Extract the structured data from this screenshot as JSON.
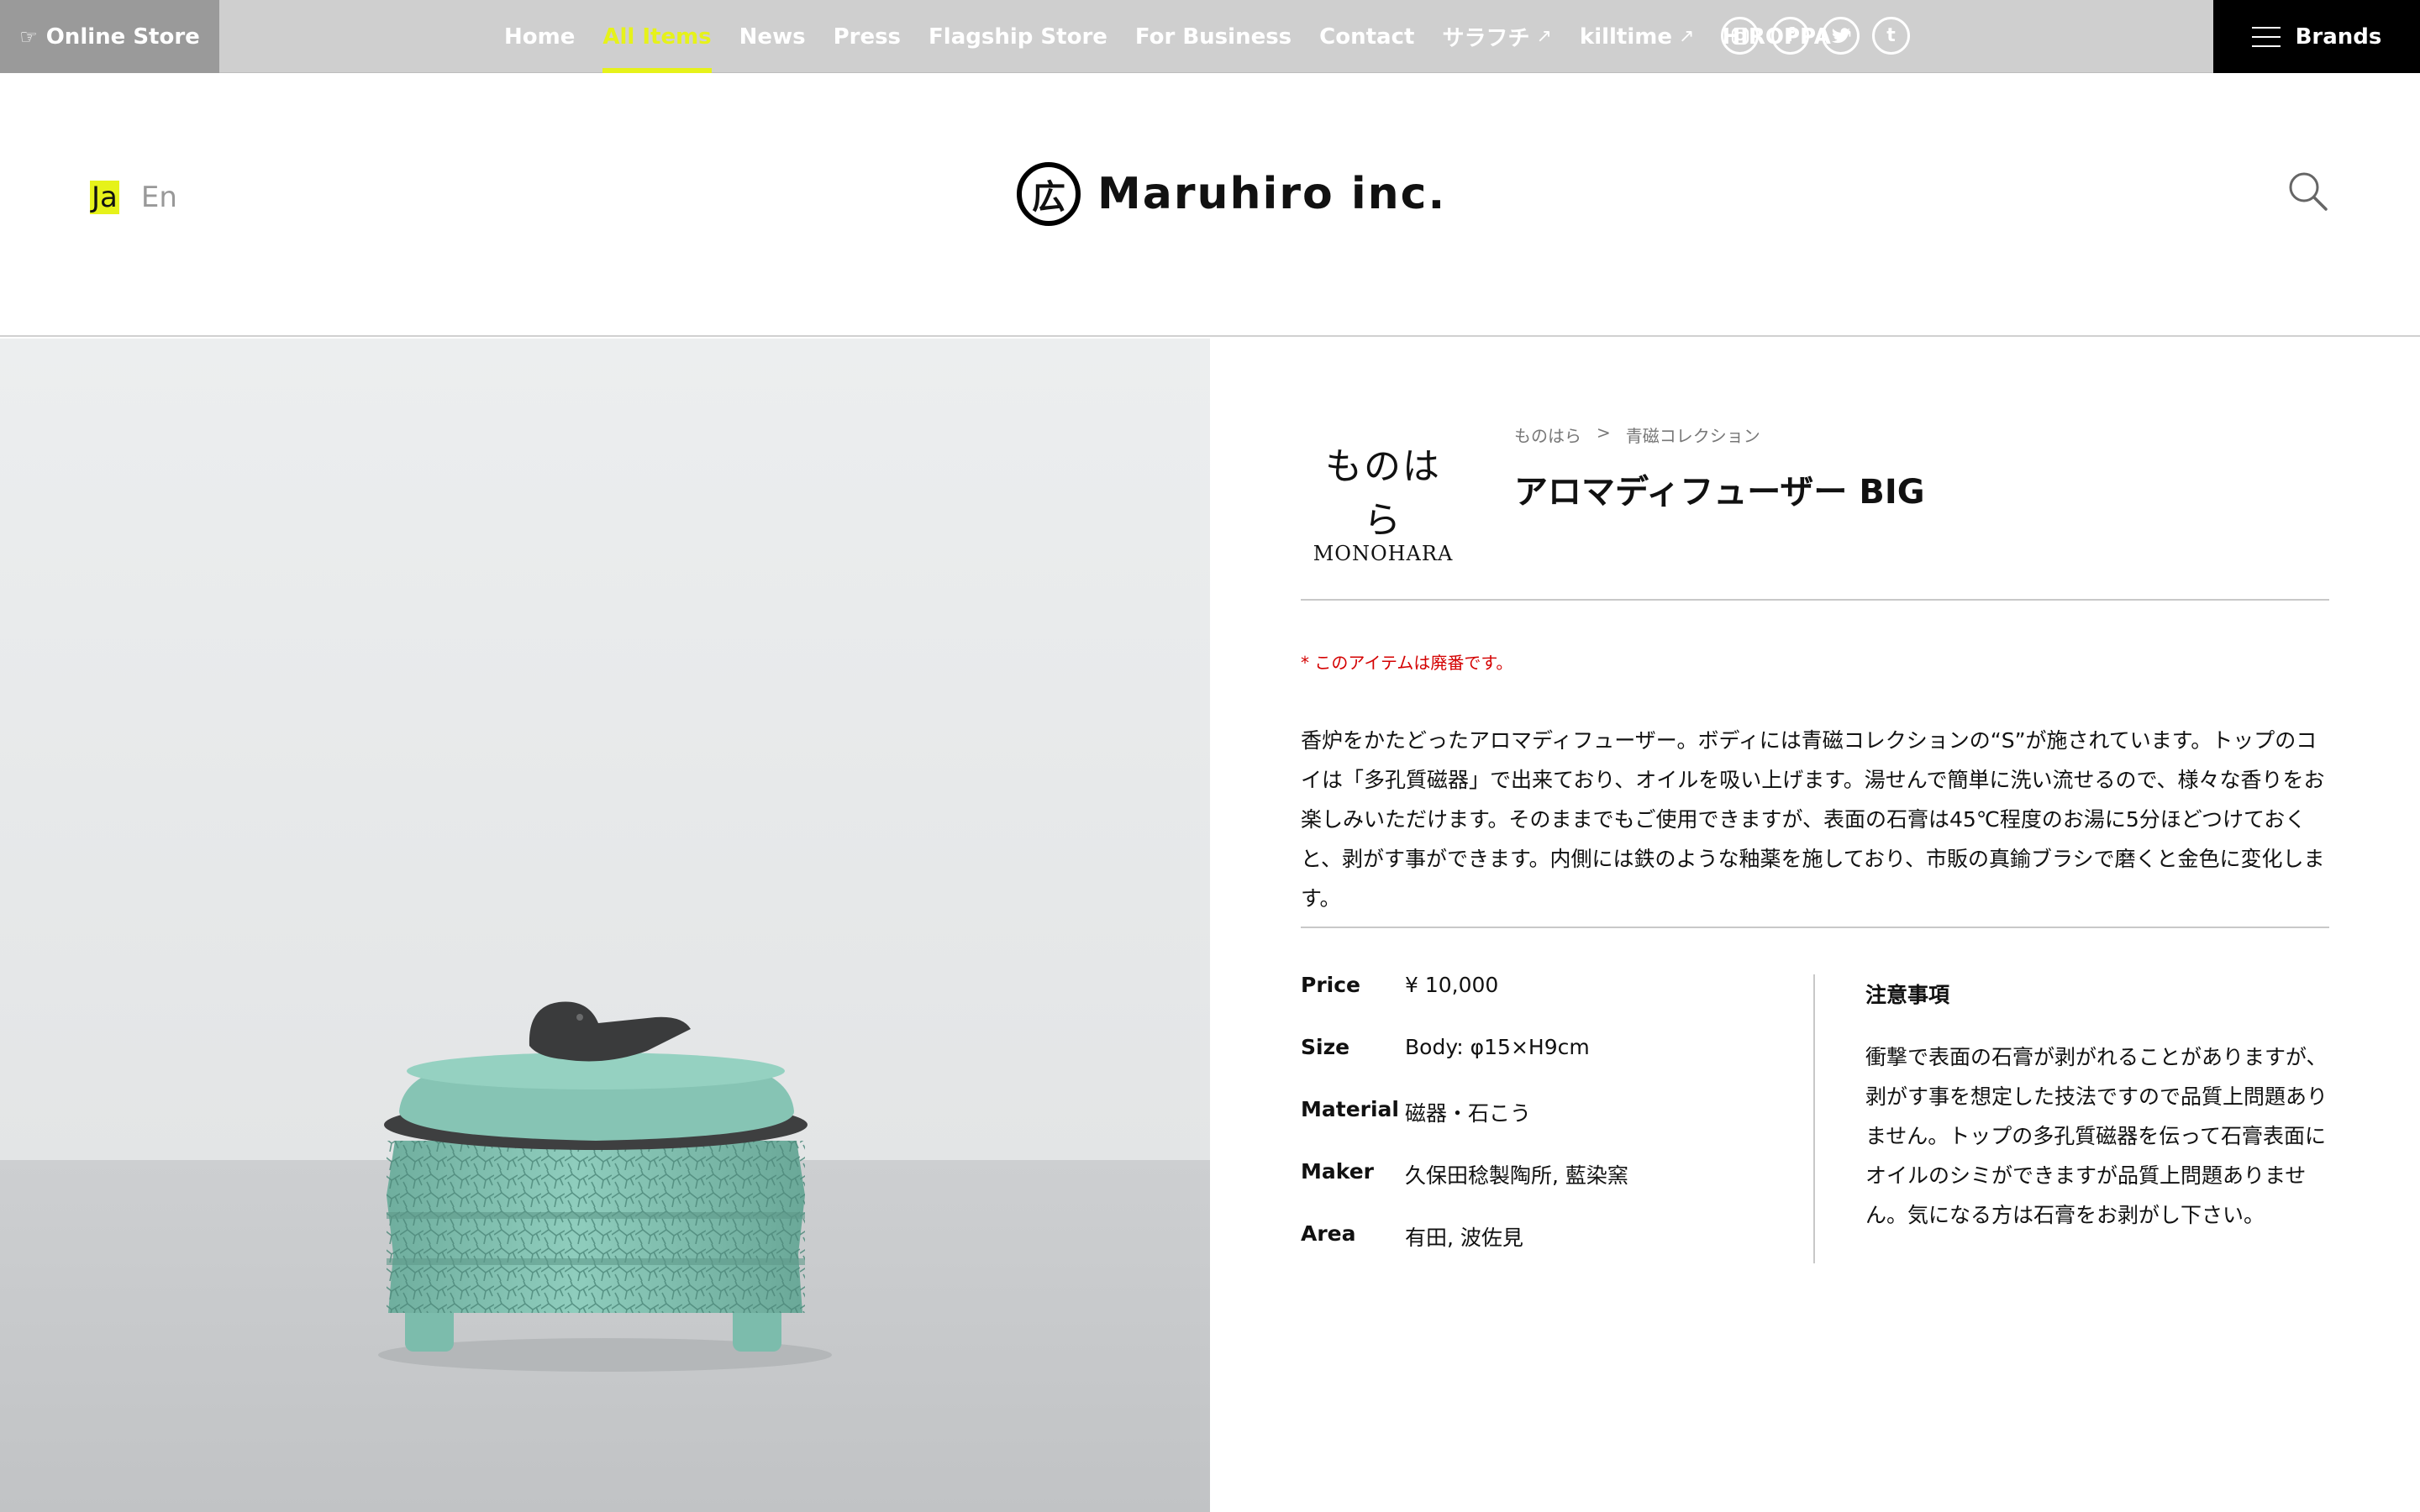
{
  "topbar": {
    "online_store": "Online Store",
    "nav": [
      {
        "label": "Home",
        "active": false,
        "external": false
      },
      {
        "label": "All Items",
        "active": true,
        "external": false
      },
      {
        "label": "News",
        "active": false,
        "external": false
      },
      {
        "label": "Press",
        "active": false,
        "external": false
      },
      {
        "label": "Flagship Store",
        "active": false,
        "external": false
      },
      {
        "label": "For Business",
        "active": false,
        "external": false
      },
      {
        "label": "Contact",
        "active": false,
        "external": false
      },
      {
        "label": "サラフチ",
        "active": false,
        "external": true
      },
      {
        "label": "killtime",
        "active": false,
        "external": true
      },
      {
        "label": "HIROPPA",
        "active": false,
        "external": true
      }
    ],
    "social_icons": [
      "instagram-icon",
      "facebook-icon",
      "twitter-icon",
      "tumblr-icon"
    ],
    "brands_label": "Brands",
    "accent_color": "#e6f21a"
  },
  "header": {
    "lang_ja": "Ja",
    "lang_en": "En",
    "logo_mark": "広",
    "logo_text": "Maruhiro inc."
  },
  "product": {
    "brand_logo_jp": "ものはら",
    "brand_logo_en": "MONOHARA",
    "breadcrumb": [
      "ものはら",
      "青磁コレクション"
    ],
    "breadcrumb_sep": ">",
    "title": "アロマディフューザー BIG",
    "notice": "* このアイテムは廃番です。",
    "description": "香炉をかたどったアロマディフューザー。ボディには青磁コレクションの“S”が施されています。トップのコイは「多孔質磁器」で出来ており、オイルを吸い上げます。湯せんで簡単に洗い流せるので、様々な香りをお楽しみいただけます。そのままでもご使用できますが、表面の石膏は45℃程度のお湯に5分ほどつけておくと、剥がす事ができます。内側には鉄のような釉薬を施しており、市販の真鍮ブラシで磨くと金色に変化します。",
    "specs": [
      {
        "key": "Price",
        "value": "¥ 10,000"
      },
      {
        "key": "Size",
        "value": "Body: φ15×H9cm"
      },
      {
        "key": "Material",
        "value": "磁器・石こう"
      },
      {
        "key": "Maker",
        "value": "久保田稔製陶所, 藍染窯"
      },
      {
        "key": "Area",
        "value": "有田, 波佐見"
      }
    ],
    "caution_title": "注意事項",
    "caution_text": "衝撃で表面の石膏が剥がれることがありますが、剥がす事を想定した技法ですので品質上問題ありません。トップの多孔質磁器を伝って石膏表面にオイルのシミができますが品質上問題ありません。気になる方は石膏をお剥がし下さい。"
  }
}
